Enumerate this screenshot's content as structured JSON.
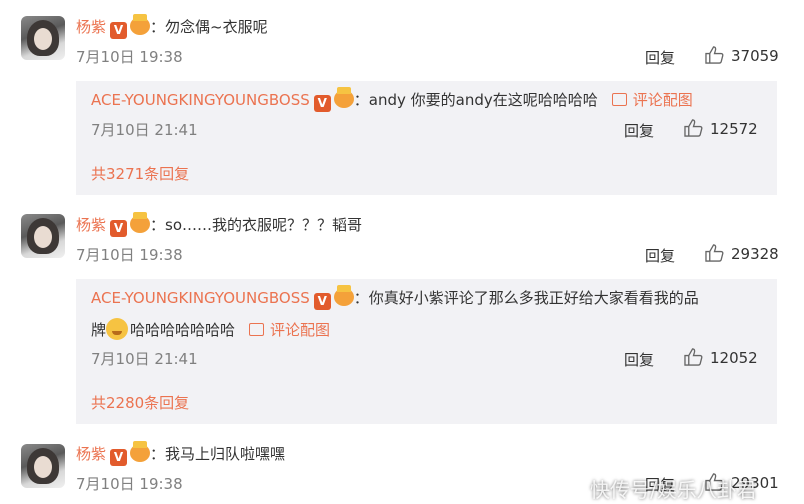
{
  "comments": [
    {
      "user": "杨紫",
      "text": "：勿念偶~衣服呢",
      "time": "7月10日 19:38",
      "reply_label": "回复",
      "likes": "37059",
      "reply": {
        "user": "ACE-YOUNGKINGYOUNGBOSS",
        "text": "：andy 你要的andy在这呢哈哈哈哈",
        "pic_label": "评论配图",
        "time": "7月10日 21:41",
        "reply_label": "回复",
        "likes": "12572"
      },
      "total": "共3271条回复"
    },
    {
      "user": "杨紫",
      "text": "：so……我的衣服呢？？？韬哥",
      "time": "7月10日 19:38",
      "reply_label": "回复",
      "likes": "29328",
      "reply": {
        "user": "ACE-YOUNGKINGYOUNGBOSS",
        "text_line1": "：你真好小紫评论了那么多我正好给大家看看我的品",
        "text_line2_a": "牌",
        "text_line2_b": "哈哈哈哈哈哈哈",
        "pic_label": "评论配图",
        "time": "7月10日 21:41",
        "reply_label": "回复",
        "likes": "12052"
      },
      "total": "共2280条回复"
    },
    {
      "user": "杨紫",
      "text": "：我马上归队啦嘿嘿",
      "time": "7月10日 19:38",
      "reply_label": "回复",
      "likes": "29301"
    }
  ],
  "badge_letter": "V",
  "watermark": "快传号/娱乐八卦君",
  "colors": {
    "name": "#eb7350",
    "reply_bg": "#f2f2f5",
    "time": "#808080"
  }
}
